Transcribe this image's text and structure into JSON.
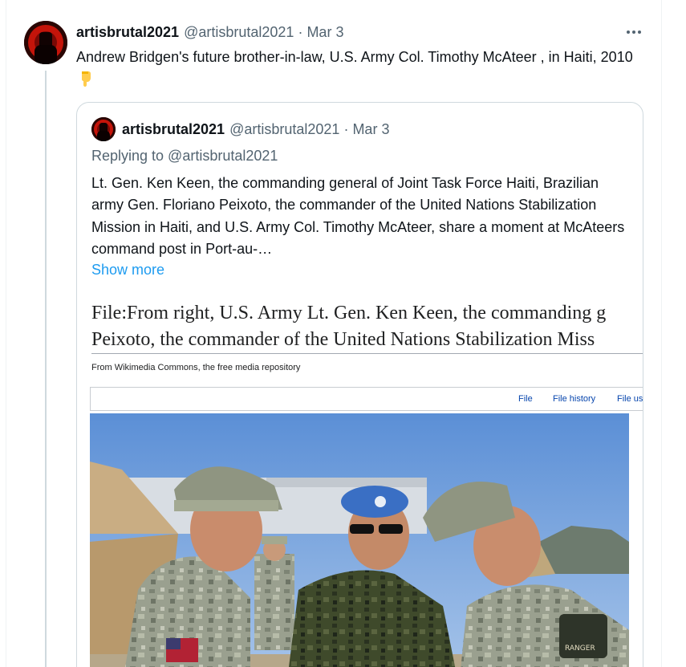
{
  "tweet": {
    "author_name": "artisbrutal2021",
    "author_handle": "@artisbrutal2021",
    "separator": "·",
    "date": "Mar 3",
    "text": "Andrew Bridgen's future brother-in-law, U.S. Army Col. Timothy McAteer , in Haiti, 2010",
    "emoji_icon": "backhand-index-pointing-down-icon"
  },
  "quote": {
    "author_name": "artisbrutal2021",
    "author_handle": "@artisbrutal2021",
    "separator": "·",
    "date": "Mar 3",
    "replying_to": "Replying to @artisbrutal2021",
    "text": "Lt. Gen. Ken Keen, the commanding general of Joint Task Force  Haiti, Brazilian army Gen. Floriano Peixoto, the commander of the United Nations Stabilization Mission in Haiti, and U.S. Army Col. Timothy McAteer, share a moment at McAteers command post in Port-au-…",
    "show_more": "Show more"
  },
  "media": {
    "title_line1": "File:From right, U.S. Army Lt. Gen. Ken Keen, the commanding g",
    "title_line2": "Peixoto, the commander of the United Nations Stabilization Miss",
    "subtitle": "From Wikimedia Commons, the free media repository",
    "tabs": [
      "File",
      "File history",
      "File usa"
    ],
    "patch_text": "RANGER"
  },
  "colors": {
    "link": "#1d9bf0",
    "muted": "#536471",
    "wiki_link": "#0645ad",
    "un_beret": "#3a6fc4"
  }
}
